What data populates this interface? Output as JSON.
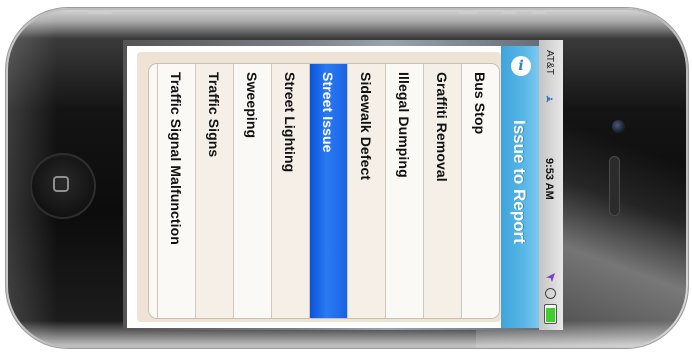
{
  "status_bar": {
    "carrier": "AT&T",
    "time": "9:53 AM",
    "battery_level": 0.85
  },
  "header": {
    "title": "Issue to Report",
    "info_icon": "info-icon",
    "accent_color": "#4aaee2"
  },
  "list": {
    "selected_index": 4,
    "selected_color": "#1a63e4",
    "items": [
      {
        "label": "Bus Stop"
      },
      {
        "label": "Graffiti Removal"
      },
      {
        "label": "Illegal Dumping"
      },
      {
        "label": "Sidewalk Defect"
      },
      {
        "label": "Street Issue"
      },
      {
        "label": "Street Lighting"
      },
      {
        "label": "Sweeping"
      },
      {
        "label": "Traffic Signs"
      },
      {
        "label": "Traffic Signal Malfunction"
      }
    ]
  }
}
